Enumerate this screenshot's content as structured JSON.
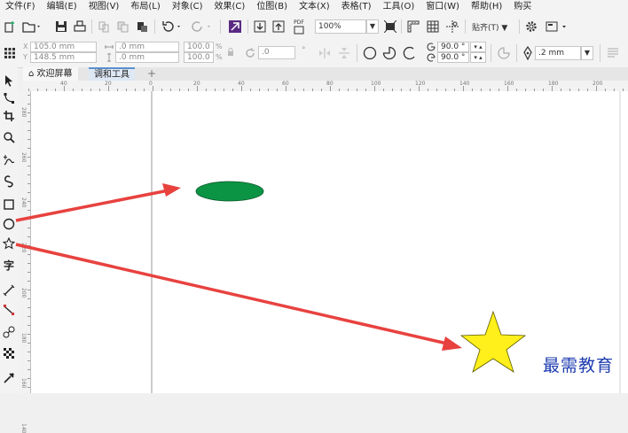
{
  "menu": [
    "文件(F)",
    "编辑(E)",
    "视图(V)",
    "布局(L)",
    "对象(C)",
    "效果(C)",
    "位图(B)",
    "文本(X)",
    "表格(T)",
    "工具(O)",
    "窗口(W)",
    "帮助(H)",
    "购买"
  ],
  "toolbar1": {
    "zoom_value": "100%",
    "snap_label": "贴齐(T)",
    "pdf_label": "PDF"
  },
  "toolbar2": {
    "x_value": "105.0 mm",
    "y_value": "148.5 mm",
    "width_value": ".0 mm",
    "height_value": ".0 mm",
    "scale_x": "100.0",
    "scale_y": "100.0",
    "percent_x": "%",
    "percent_y": "%",
    "rotation_value": ".0",
    "start_angle": "90.0 °",
    "end_angle": "90.0 °",
    "outline_width": ".2 mm"
  },
  "tabs": {
    "welcome": "欢迎屏幕",
    "tune": "调和工具",
    "add": "+"
  },
  "ruler": {
    "h_labels": [
      "40",
      "20",
      "0",
      "20",
      "40",
      "60",
      "80",
      "100",
      "120",
      "140",
      "160",
      "180",
      "200"
    ],
    "v_labels": [
      "280",
      "260",
      "240",
      "220",
      "200",
      "180",
      "160",
      "140"
    ]
  },
  "toolbox_icons": [
    "pick-tool",
    "shape-tool",
    "crop-tool",
    "zoom-tool",
    "freehand-tool",
    "artistic-media-tool",
    "rectangle-tool",
    "ellipse-tool",
    "polygon-tool",
    "text-tool",
    "parallel-dimension-tool",
    "connector-tool",
    "blend-tool",
    "transparency-tool",
    "eyedropper-tool"
  ],
  "canvas": {
    "ellipse_fill": "#0b9444",
    "star_fill": "#ffef1a",
    "arrow_color": "#e8423f"
  },
  "watermark": "最需教育"
}
